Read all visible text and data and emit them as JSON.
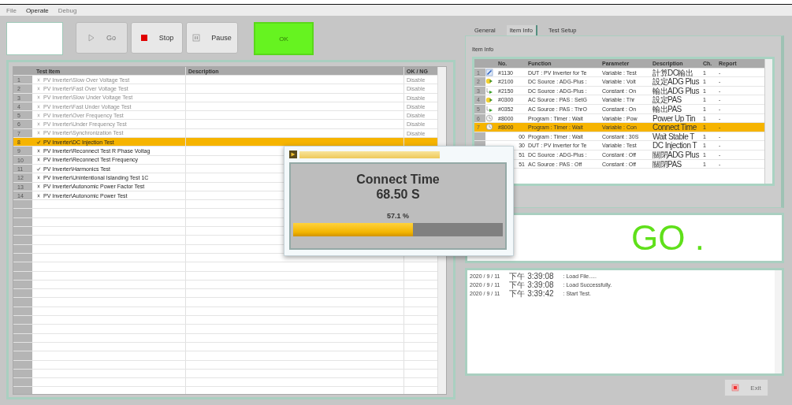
{
  "menu": [
    {
      "label": "File",
      "disabled": true
    },
    {
      "label": "Operate",
      "disabled": false
    },
    {
      "label": "Debug",
      "disabled": true
    }
  ],
  "toolbar": {
    "buttons": [
      {
        "kind": "go",
        "label": "Go",
        "disabled": true
      },
      {
        "kind": "stop",
        "label": "Stop",
        "disabled": false
      },
      {
        "kind": "pause",
        "label": "Pause",
        "disabled": false
      }
    ],
    "status": "OK"
  },
  "test_table": {
    "columns": [
      "Test Item",
      "Description",
      "OK / NG"
    ],
    "rows": [
      {
        "num": "1",
        "item": "PV Inverter\\Slow Over Voltage Test",
        "checked": false,
        "disabled": true,
        "result": "Disable",
        "selected": false
      },
      {
        "num": "2",
        "item": "PV Inverter\\Fast Over Voltage Test",
        "checked": false,
        "disabled": true,
        "result": "Disable",
        "selected": false
      },
      {
        "num": "3",
        "item": "PV Inverter\\Slow Under Voltage Test",
        "checked": false,
        "disabled": true,
        "result": "Disable",
        "selected": false
      },
      {
        "num": "4",
        "item": "PV Inverter\\Fast Under Voltage Test",
        "checked": false,
        "disabled": true,
        "result": "Disable",
        "selected": false
      },
      {
        "num": "5",
        "item": "PV Inverter\\Over Frequency Test",
        "checked": false,
        "disabled": true,
        "result": "Disable",
        "selected": false
      },
      {
        "num": "6",
        "item": "PV Inverter\\Under Frequency Test",
        "checked": false,
        "disabled": true,
        "result": "Disable",
        "selected": false
      },
      {
        "num": "7",
        "item": "PV Inverter\\Synchronization Test",
        "checked": false,
        "disabled": true,
        "result": "Disable",
        "selected": false
      },
      {
        "num": "8",
        "item": "PV Inverter\\DC Injection Test",
        "checked": true,
        "disabled": false,
        "selected": true
      },
      {
        "num": "9",
        "item": "PV Inverter\\Reconnect Test R Phase Voltag",
        "checked": false,
        "disabled": false,
        "selected": false
      },
      {
        "num": "10",
        "item": "PV Inverter\\Reconnect Test Frequency",
        "checked": false,
        "disabled": false,
        "selected": false
      },
      {
        "num": "11",
        "item": "PV Inverter\\Harmonics Test",
        "checked": true,
        "disabled": false,
        "selected": false
      },
      {
        "num": "12",
        "item": "PV Inverter\\Unintentional Islanding Test 1C",
        "checked": false,
        "disabled": false,
        "selected": false
      },
      {
        "num": "13",
        "item": "PV Inverter\\Autonomic Power Factor Test",
        "checked": false,
        "disabled": false,
        "selected": false
      },
      {
        "num": "14",
        "item": "PV Inverter\\Autonomic Power Test",
        "checked": false,
        "disabled": false,
        "selected": false
      }
    ]
  },
  "tabs": [
    {
      "label": "General",
      "selected": false
    },
    {
      "label": "Item Info",
      "selected": true
    },
    {
      "label": "Test Setup",
      "selected": false
    }
  ],
  "item_info": {
    "title": "Item Info",
    "columns": [
      "No.",
      "Function",
      "Parameter",
      "Description",
      "Ch.",
      "Report"
    ],
    "rows": [
      {
        "num": "1",
        "kind": "edit",
        "no": "#1130",
        "function": "DUT : PV Inverter for Te",
        "parameter": "Variable : Test",
        "description": "計算DC輸出",
        "ch": "1",
        "report": "-",
        "selected": false
      },
      {
        "num": "2",
        "kind": "set",
        "no": "#2100",
        "function": "DC Source : ADG-Plus :",
        "parameter": "Variable : Volt",
        "description": "設定ADG Plus",
        "ch": "1",
        "report": "-",
        "selected": false
      },
      {
        "num": "3",
        "kind": "output",
        "no": "#2150",
        "function": "DC Source : ADG-Plus :",
        "parameter": "Constant : On",
        "description": "輸出ADG Plus",
        "ch": "1",
        "report": "-",
        "selected": false
      },
      {
        "num": "4",
        "kind": "set",
        "no": "#0300",
        "function": "AC Source : PAS : SetG",
        "parameter": "Variable : Thr",
        "description": "設定PAS",
        "ch": "1",
        "report": "-",
        "selected": false
      },
      {
        "num": "5",
        "kind": "output",
        "no": "#0352",
        "function": "AC Source : PAS : ThrO",
        "parameter": "Constant : On",
        "description": "輸出PAS",
        "ch": "1",
        "report": "-",
        "selected": false
      },
      {
        "num": "6",
        "kind": "timer",
        "no": "#8000",
        "function": "Program : Timer : Wait",
        "parameter": "Variable : Pow",
        "description": "Power Up Tin",
        "ch": "1",
        "report": "-",
        "selected": false
      },
      {
        "num": "7",
        "kind": "timer",
        "no": "#8000",
        "function": "Program : Timer : Wait",
        "parameter": "Variable : Con",
        "description": "Connect Time",
        "ch": "1",
        "report": "-",
        "selected": true
      },
      {
        "no": "00",
        "function": "Program : Timer : Wait",
        "parameter": "Constant : 30S",
        "description": "Wait Stable T",
        "ch": "1",
        "report": "-",
        "selected": false
      },
      {
        "no": "30",
        "function": "DUT : PV Inverter for Te",
        "parameter": "Variable : Test",
        "description": "DC Injection T",
        "ch": "1",
        "report": "-",
        "selected": false
      },
      {
        "no": "51",
        "function": "DC Source : ADG-Plus :",
        "parameter": "Constant : Off",
        "description": "關閉ADG Plus",
        "ch": "1",
        "report": "-",
        "selected": false
      },
      {
        "no": "51",
        "function": "AC Source : PAS : Off",
        "parameter": "Constant : Off",
        "description": "關閉PAS",
        "ch": "1",
        "report": "-",
        "selected": false
      }
    ]
  },
  "go_panel": "GO .",
  "log": [
    {
      "date": "2020 / 9 / 11",
      "time": "下午 3:39:08",
      "message": ": Load File....."
    },
    {
      "date": "2020 / 9 / 11",
      "time": "下午 3:39:08",
      "message": ": Load Successfully."
    },
    {
      "date": "2020 / 9 / 11",
      "time": "下午 3:39:42",
      "message": ": Start Test."
    }
  ],
  "exit_button": {
    "label": "Exit",
    "disabled": true
  },
  "popup": {
    "title": "Connect Time",
    "value": "68.50 S",
    "percent": "57.1 %",
    "level": 0.571
  }
}
